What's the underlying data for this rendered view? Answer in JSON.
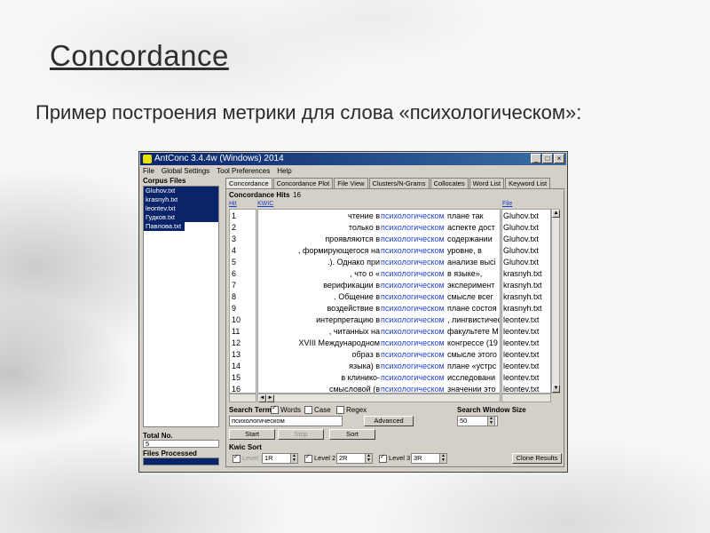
{
  "slide": {
    "title": "Concordance",
    "subtitle": "Пример построения метрики для слова «психологическом»:"
  },
  "window": {
    "title": "AntConc 3.4.4w (Windows) 2014",
    "controls": [
      "_",
      "□",
      "×"
    ]
  },
  "menu": [
    "File",
    "Global Settings",
    "Tool Preferences",
    "Help"
  ],
  "sidebar": {
    "corpus_label": "Corpus Files",
    "files": [
      "Gluhov.txt",
      "krasnyh.txt",
      "leontev.txt",
      "Гудков.txt",
      "Павлова.txt"
    ],
    "total_label": "Total No.",
    "total_value": "5",
    "processed_label": "Files Processed",
    "processed_fraction": 1.0
  },
  "tabs": [
    "Concordance",
    "Concordance Plot",
    "File View",
    "Clusters/N-Grams",
    "Collocates",
    "Word List",
    "Keyword List"
  ],
  "active_tab": 0,
  "concordance": {
    "hits_label": "Concordance Hits",
    "hits_count": "16",
    "col_hit": "Hit",
    "col_kwic": "KWIC",
    "col_file": "File",
    "rows": [
      {
        "hit": "1",
        "left": "чтение в",
        "kw": "психологическом",
        "right": "плане так",
        "file": "Gluhov.txt"
      },
      {
        "hit": "2",
        "left": "только в",
        "kw": "психологическом",
        "right": "аспекте дост",
        "file": "Gluhov.txt"
      },
      {
        "hit": "3",
        "left": "проявляются в",
        "kw": "психологическом",
        "right": "содержании",
        "file": "Gluhov.txt"
      },
      {
        "hit": "4",
        "left": ", формирующегося на",
        "kw": "психологическом",
        "right": "уровне, в",
        "file": "Gluhov.txt"
      },
      {
        "hit": "5",
        "left": ".). Однако при",
        "kw": "психологическом",
        "right": "анализе высі",
        "file": "Gluhov.txt"
      },
      {
        "hit": "6",
        "left": ", что о «",
        "kw": "психологическом",
        "right": "в языке»,",
        "file": "krasnyh.txt"
      },
      {
        "hit": "7",
        "left": "верификации в",
        "kw": "психологическом",
        "right": "эксперимент",
        "file": "krasnyh.txt"
      },
      {
        "hit": "8",
        "left": ". Общение в",
        "kw": "психологическом",
        "right": "смысле всег",
        "file": "krasnyh.txt"
      },
      {
        "hit": "9",
        "left": "воздействие в",
        "kw": "психологическом",
        "right": "плане состоя",
        "file": "krasnyh.txt"
      },
      {
        "hit": "10",
        "left": "интерпретацию в",
        "kw": "психологическом",
        "right": ", лингвистичес",
        "file": "leontev.txt"
      },
      {
        "hit": "11",
        "left": ", читанных на",
        "kw": "психологическом",
        "right": "факультете М",
        "file": "leontev.txt"
      },
      {
        "hit": "12",
        "left": "XVIII Международном",
        "kw": "психологическом",
        "right": "конгрессе (19",
        "file": "leontev.txt"
      },
      {
        "hit": "13",
        "left": "образ в",
        "kw": "психологическом",
        "right": "смысле этого",
        "file": "leontev.txt"
      },
      {
        "hit": "14",
        "left": "языка) в",
        "kw": "психологическом",
        "right": "плане «устрс",
        "file": "leontev.txt"
      },
      {
        "hit": "15",
        "left": "в клинико-",
        "kw": "психологическом",
        "right": "исследовани",
        "file": "leontev.txt"
      },
      {
        "hit": "16",
        "left": "смысловой (в",
        "kw": "психологическом",
        "right": "значении это",
        "file": "leontev.txt"
      }
    ]
  },
  "search": {
    "label": "Search Term",
    "words_label": "Words",
    "words_checked": true,
    "case_label": "Case",
    "case_checked": false,
    "regex_label": "Regex",
    "regex_checked": false,
    "term": "психологическом",
    "advanced_label": "Advanced",
    "start_label": "Start",
    "stop_label": "Stop",
    "sort_label": "Sort",
    "window_label": "Search Window Size",
    "window_value": "50"
  },
  "kwic_sort": {
    "label": "Kwic Sort",
    "level1_label": "Level 1",
    "level1_value": "1R",
    "level2_label": "Level 2",
    "level2_value": "2R",
    "level3_label": "Level 3",
    "level3_value": "3R",
    "clone_label": "Clone Results"
  }
}
